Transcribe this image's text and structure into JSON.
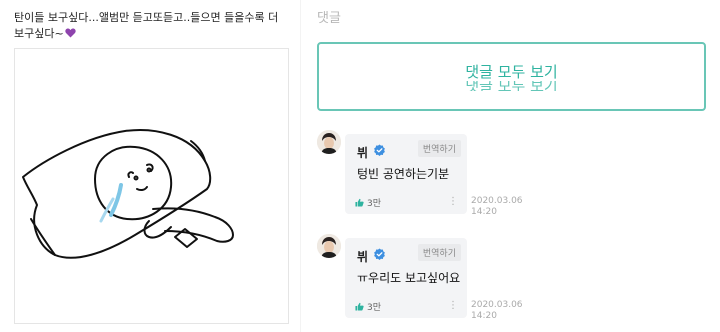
{
  "post": {
    "text_line1": "탄이들 보구싶다...앨범만 듣고또듣고..들으면 들을수록 더",
    "text_line2": "보구싶다~",
    "heart_color": "#8e44ad"
  },
  "comments_section": {
    "title": "댓글",
    "view_all_label": "댓글 모두 보기",
    "view_all_label_ghost": "댓글 모두 보기",
    "accent_color": "#2fb3a0"
  },
  "comments": [
    {
      "author": "뷔",
      "translate_label": "번역하기",
      "text": "텅빈 공연하는기분",
      "likes": "3만",
      "date": "2020.03.06",
      "time": "14:20"
    },
    {
      "author": "뷔",
      "translate_label": "번역하기",
      "text": "ㅠ우리도 보고싶어요",
      "likes": "3만",
      "date": "2020.03.06",
      "time": "14:20"
    }
  ]
}
